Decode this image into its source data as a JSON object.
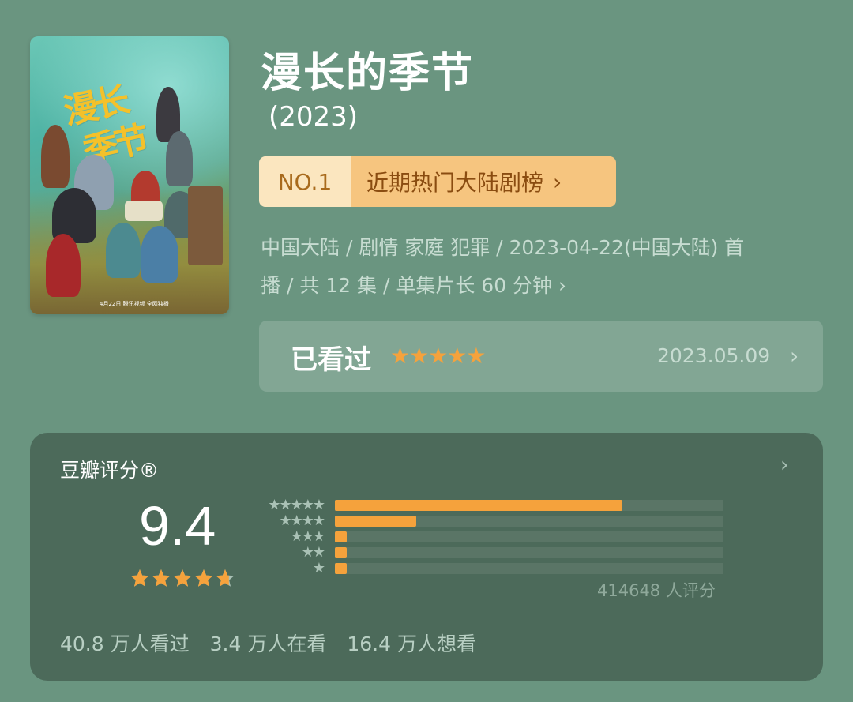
{
  "poster": {
    "title_line1": "漫长",
    "title_line2": "季节",
    "release_text": "4月22日 腾讯视频 全网独播"
  },
  "header": {
    "title": "漫长的季节",
    "year": "(2023)"
  },
  "rank": {
    "no": "NO.1",
    "list": "近期热门大陆剧榜"
  },
  "meta": {
    "line1": "中国大陆 / 剧情 家庭 犯罪 / 2023-04-22(中国大陆) 首",
    "line2": "播 / 共 12 集 / 单集片长 60 分钟"
  },
  "watched": {
    "label": "已看过",
    "user_stars": 5,
    "date": "2023.05.09"
  },
  "rating": {
    "header": "豆瓣评分®",
    "score": "9.4",
    "score_stars": 4.7,
    "distribution": [
      {
        "stars": 5,
        "fraction": 0.74
      },
      {
        "stars": 4,
        "fraction": 0.21
      },
      {
        "stars": 3,
        "fraction": 0.03
      },
      {
        "stars": 2,
        "fraction": 0.03
      },
      {
        "stars": 1,
        "fraction": 0.03
      }
    ],
    "count": "414648 人评分",
    "stats": {
      "watched": "40.8 万人看过",
      "watching": "3.4 万人在看",
      "wish": "16.4 万人想看"
    }
  },
  "colors": {
    "background": "#6a9580",
    "accent_star": "#f5a23c",
    "rank_no_bg": "#fbe6bf",
    "rank_list_bg": "#f6c57f",
    "rating_card_bg": "#4c6a5a"
  },
  "icons": {
    "rank_chevron": "chevron-right-icon",
    "meta_chevron": "chevron-right-icon",
    "watched_chevron": "chevron-right-icon",
    "rating_chevron": "chevron-right-icon",
    "star": "star-icon"
  }
}
